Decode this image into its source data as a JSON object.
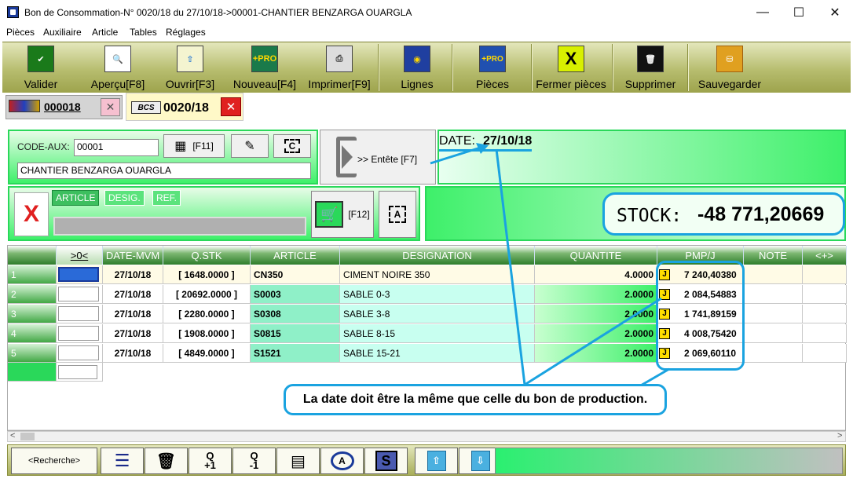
{
  "window": {
    "title": "Bon de Consommation-N° 0020/18 du 27/10/18->00001-CHANTIER BENZARGA OUARGLA",
    "minimize": "—",
    "maximize": "☐",
    "close": "✕"
  },
  "menu": [
    "Pièces",
    "Auxiliaire",
    "Article",
    "Tables",
    "Réglages"
  ],
  "toolbar": [
    {
      "label": "Valider",
      "icon": "validate-icon"
    },
    {
      "label": "Aperçu[F8]",
      "icon": "preview-icon"
    },
    {
      "label": "Ouvrir[F3]",
      "icon": "open-icon"
    },
    {
      "label": "Nouveau[F4]",
      "icon": "new-icon"
    },
    {
      "label": "Imprimer[F9]",
      "icon": "printer-icon"
    },
    {
      "label": "Lignes",
      "icon": "lines-icon"
    },
    {
      "label": "Pièces",
      "icon": "pieces-icon"
    },
    {
      "label": "Fermer pièces",
      "icon": "close-pieces-icon"
    },
    {
      "label": "Supprimer",
      "icon": "trash-icon"
    },
    {
      "label": "Sauvegarder",
      "icon": "save-icon"
    }
  ],
  "icon_text": {
    "pro": "+PRO",
    "pro_small": "+PRO",
    "x": "X",
    "c": "C",
    "a": "A",
    "s": "S",
    "q_plus": "Q\n+1",
    "q_minus": "Q\n-1"
  },
  "doc_tabs": {
    "tab1": {
      "label": "000018",
      "close": "✕"
    },
    "tab2": {
      "badge": "BCS",
      "label": "0020/18",
      "close": "✕"
    }
  },
  "header_panel": {
    "code_aux_label": "CODE-AUX:",
    "code_aux_value": "00001",
    "f11_label": "[F11]",
    "client_name": "CHANTIER BENZARGA OUARGLA",
    "entete_label": ">> Entête [F7]",
    "date_label": "DATE:",
    "date_value": "27/10/18"
  },
  "article_panel": {
    "delete": "X",
    "tabs": [
      "ARTICLE",
      "DESIG.",
      "REF."
    ],
    "f12_label": "[F12]",
    "search_value": ""
  },
  "stock": {
    "label": "STOCK:",
    "value": "-48 771,20669"
  },
  "grid": {
    "columns": [
      "",
      ">0<",
      "DATE-MVM",
      "Q.STK",
      "ARTICLE",
      "DESIGNATION",
      "QUANTITE",
      "PMP/J",
      "NOTE",
      "<+>"
    ],
    "rows": [
      {
        "num": "1",
        "date": "27/10/18",
        "qstk": "[ 1648.0000 ]",
        "article": "CN350",
        "designation": "CIMENT NOIRE 350",
        "quantite": "4.0000",
        "j": "J",
        "pmp": "7 240,40380"
      },
      {
        "num": "2",
        "date": "27/10/18",
        "qstk": "[ 20692.0000 ]",
        "article": "S0003",
        "designation": "SABLE 0-3",
        "quantite": "2.0000",
        "j": "J",
        "pmp": "2 084,54883"
      },
      {
        "num": "3",
        "date": "27/10/18",
        "qstk": "[ 2280.0000 ]",
        "article": "S0308",
        "designation": "SABLE 3-8",
        "quantite": "2.0000",
        "j": "J",
        "pmp": "1 741,89159"
      },
      {
        "num": "4",
        "date": "27/10/18",
        "qstk": "[ 1908.0000 ]",
        "article": "S0815",
        "designation": "SABLE 8-15",
        "quantite": "2.0000",
        "j": "J",
        "pmp": "4 008,75420"
      },
      {
        "num": "5",
        "date": "27/10/18",
        "qstk": "[ 4849.0000 ]",
        "article": "S1521",
        "designation": "SABLE 15-21",
        "quantite": "2.0000",
        "j": "J",
        "pmp": "2 069,60110"
      }
    ]
  },
  "annotation": "La date doit être la même que celle du bon de production.",
  "bottombar": {
    "search": "<Recherche>",
    "scroll_left": "<",
    "scroll_right": ">"
  },
  "colors": {
    "accent_green": "#2ad85a",
    "callout_blue": "#1aa3e0",
    "toolbar_olive": "#b7bd6f",
    "delete_red": "#e02020"
  }
}
